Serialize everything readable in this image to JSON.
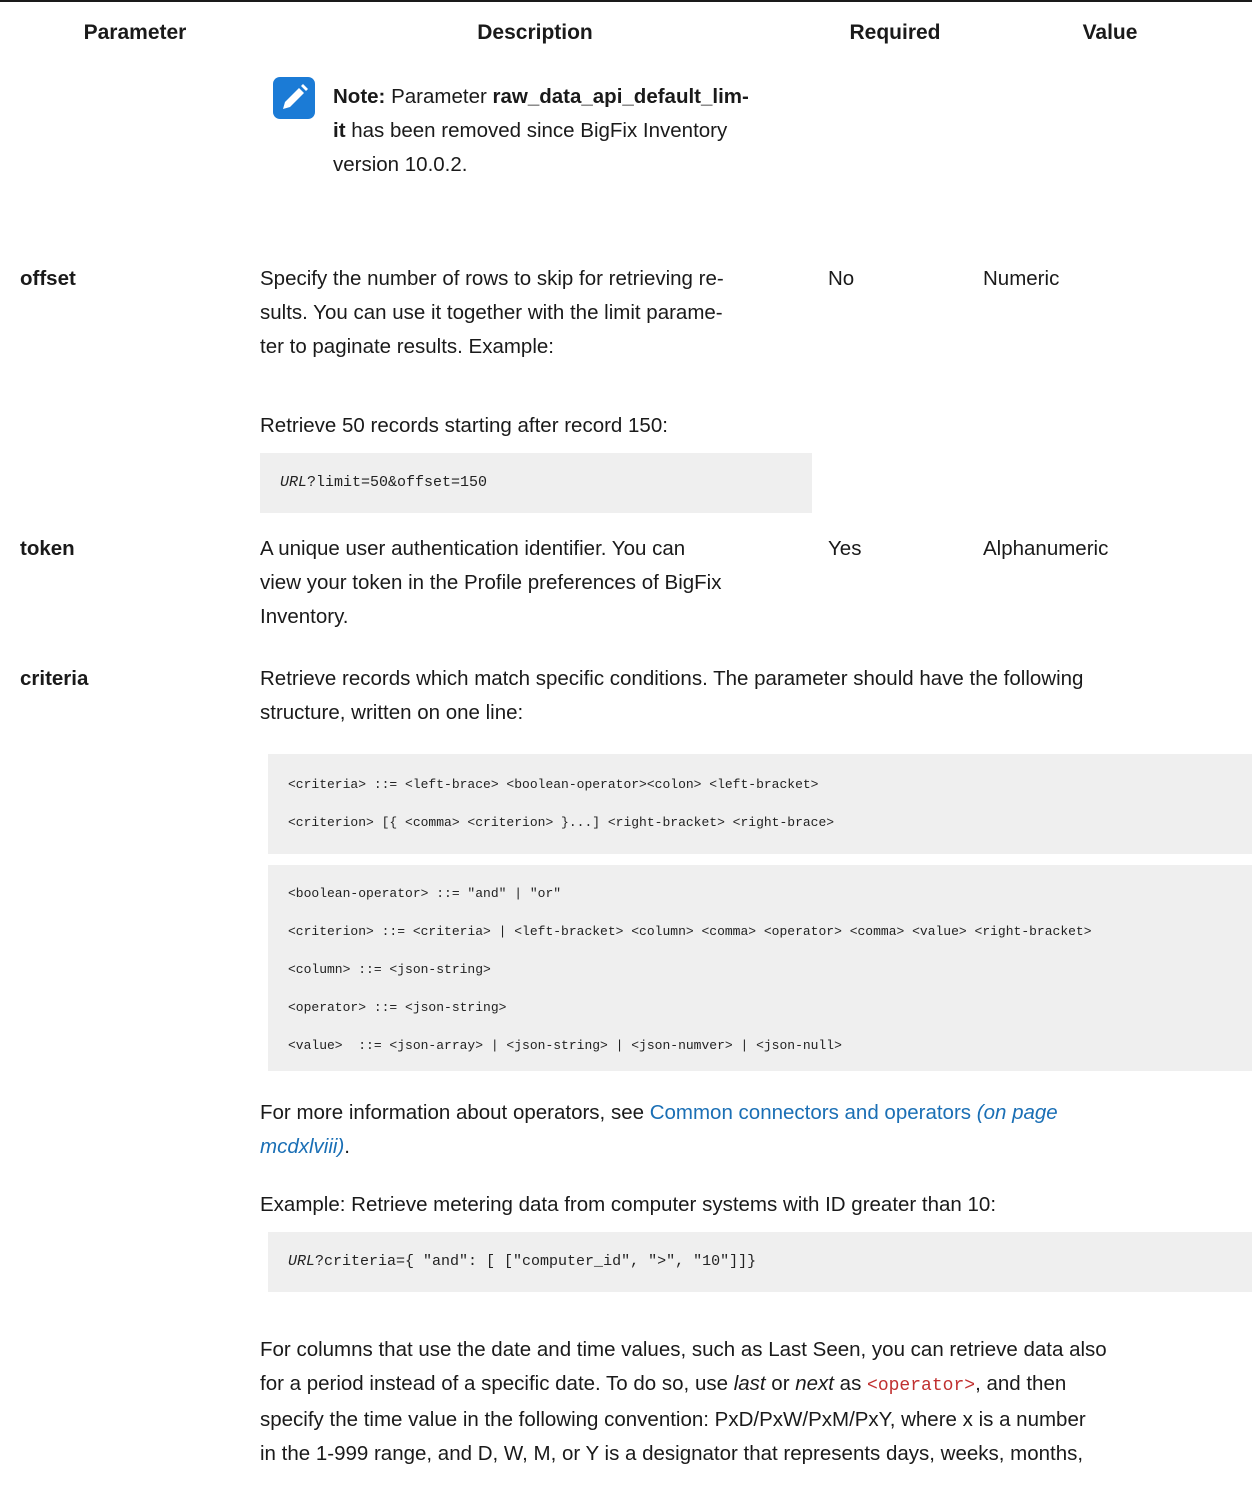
{
  "table": {
    "headers": {
      "parameter": "Parameter",
      "description": "Description",
      "required": "Required",
      "value": "Value"
    },
    "note": {
      "label": "Note:",
      "line1_pre": "Parameter ",
      "param_part1": "raw_data_api_default_lim-",
      "param_part2": "it",
      "line2_rest": " has been removed since BigFix Inventory",
      "line3": "version 10.0.2."
    },
    "rows": [
      {
        "name": "offset",
        "desc_lines": [
          "Specify the number of rows to skip for retrieving re-",
          "sults. You can use it together with the limit parame-",
          "ter to paginate results. Example:"
        ],
        "example_text": "Retrieve 50 records starting after record 150:",
        "code_var": "URL",
        "code_rest": "?limit=50&offset=150",
        "required": "No",
        "value": "Numeric"
      },
      {
        "name": "token",
        "desc_lines": [
          "A unique user authentication identifier. You can",
          "view your token in the Profile preferences of BigFix",
          "Inventory."
        ],
        "required": "Yes",
        "value": "Alphanumeric"
      },
      {
        "name": "criteria",
        "desc_lines": [
          "Retrieve records which match specific conditions. The parameter should have the following",
          "structure, written on one line:"
        ],
        "code_block1": [
          "<criteria> ::= <left-brace> <boolean-operator><colon> <left-bracket>",
          "<criterion> [{ <comma> <criterion> }...] <right-bracket> <right-brace>"
        ],
        "code_block2": [
          "<boolean-operator> ::= \"and\" | \"or\"",
          "<criterion> ::= <criteria> | <left-bracket> <column> <comma> <operator> <comma> <value> <right-bracket>",
          "<column> ::= <json-string>",
          "<operator> ::= <json-string>",
          "<value>  ::= <json-array> | <json-string> | <json-numver> | <json-null>"
        ],
        "more_info_pre": "For more information about operators, see ",
        "more_info_link": "Common connectors and operators",
        "more_info_page_a": " (on page",
        "more_info_page_b": "mcdxlviii)",
        "more_info_end": ".",
        "example2_text": "Example: Retrieve metering data from computer systems with ID greater than 10:",
        "code2_var": "URL",
        "code2_rest": "?criteria={ \"and\": [ [\"computer_id\", \">\", \"10\"]]}",
        "para_line1": "For columns that use the date and time values, such as Last Seen, you can retrieve data also",
        "para_line2_a": "for a period instead of a specific date. To do so, use ",
        "para_line2_last": "last",
        "para_line2_or": " or ",
        "para_line2_next": "next",
        "para_line2_as": " as ",
        "para_line2_op": "<operator>",
        "para_line2_end": ", and then",
        "para_line3": "specify the time value in the following convention: PxD/PxW/PxM/PxY, where x is a number",
        "para_line4": "in the 1-999 range, and D, W, M, or Y is a designator that represents days, weeks, months,"
      }
    ]
  },
  "colors": {
    "link": "#1a6fb5",
    "code_bg": "#efefef",
    "note_icon": "#1b7bd6",
    "operator": "#c03030"
  }
}
